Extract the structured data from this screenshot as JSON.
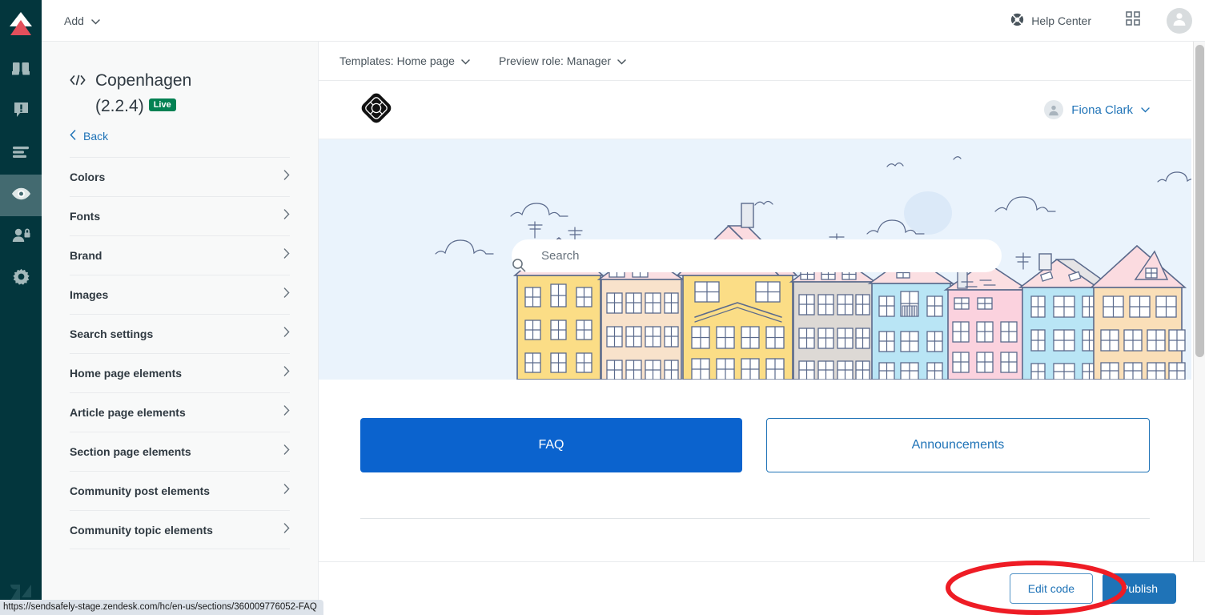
{
  "rail": {
    "logo_icon": "zendesk-arrow-logo",
    "items": [
      {
        "icon": "guide-book-icon",
        "name": "knowledge-base",
        "active": false
      },
      {
        "icon": "announcement-icon",
        "name": "announcements",
        "active": false
      },
      {
        "icon": "list-lines-icon",
        "name": "arrange-content",
        "active": false
      },
      {
        "icon": "eye-icon",
        "name": "customize-design",
        "active": true
      },
      {
        "icon": "user-lock-icon",
        "name": "user-permissions",
        "active": false
      },
      {
        "icon": "gear-icon",
        "name": "settings",
        "active": false
      }
    ],
    "bottom_icon": "zendesk-logo"
  },
  "topbar": {
    "add_label": "Add",
    "add_chevron_icon": "chevron-down-icon",
    "help_center_label": "Help Center",
    "help_center_icon": "lifebuoy-icon",
    "apps_icon": "grid-apps-icon",
    "avatar_icon": "user-avatar-icon"
  },
  "sidebar": {
    "code_icon": "code-brackets-icon",
    "theme_name": "Copenhagen",
    "theme_version": "(2.2.4)",
    "status_badge": "Live",
    "back_label": "Back",
    "back_icon": "chevron-left-icon",
    "menu": [
      {
        "label": "Colors",
        "chevron": "chevron-right-icon"
      },
      {
        "label": "Fonts",
        "chevron": "chevron-right-icon"
      },
      {
        "label": "Brand",
        "chevron": "chevron-right-icon"
      },
      {
        "label": "Images",
        "chevron": "chevron-right-icon"
      },
      {
        "label": "Search settings",
        "chevron": "chevron-right-icon"
      },
      {
        "label": "Home page elements",
        "chevron": "chevron-right-icon"
      },
      {
        "label": "Article page elements",
        "chevron": "chevron-right-icon"
      },
      {
        "label": "Section page elements",
        "chevron": "chevron-right-icon"
      },
      {
        "label": "Community post elements",
        "chevron": "chevron-right-icon"
      },
      {
        "label": "Community topic elements",
        "chevron": "chevron-right-icon"
      }
    ]
  },
  "preview_toolbar": {
    "templates_label": "Templates: Home page",
    "templates_chevron": "chevron-down-icon",
    "role_label": "Preview role: Manager",
    "role_chevron": "chevron-down-icon"
  },
  "help_center": {
    "brand_logo_icon": "lifebuoy-brand-logo",
    "user_name": "Fiona Clark",
    "user_avatar_icon": "user-avatar-icon",
    "user_chevron": "chevron-down-icon",
    "search_placeholder": "Search",
    "search_value": "",
    "search_icon": "magnifier-icon",
    "blocks": [
      {
        "label": "FAQ",
        "style": "primary"
      },
      {
        "label": "Announcements",
        "style": "secondary"
      }
    ],
    "hero_illustration": "copenhagen-cityscape-illustration"
  },
  "actions": {
    "edit_code_label": "Edit code",
    "publish_label": "Publish"
  },
  "annotation": {
    "shape": "red-ellipse-highlight",
    "color": "#ee1c25"
  },
  "status_bar": {
    "url": "https://sendsafely-stage.zendesk.com/hc/en-us/sections/360009776052-FAQ"
  },
  "colors": {
    "rail_bg": "#03363d",
    "rail_active": "#436a70",
    "sidebar_bg": "#f8f9f9",
    "link_blue": "#1f73b7",
    "primary_blue": "#0b63ce",
    "live_green": "#038153",
    "hero_sky": "#eaf3fc",
    "annotation_red": "#ee1c25"
  }
}
